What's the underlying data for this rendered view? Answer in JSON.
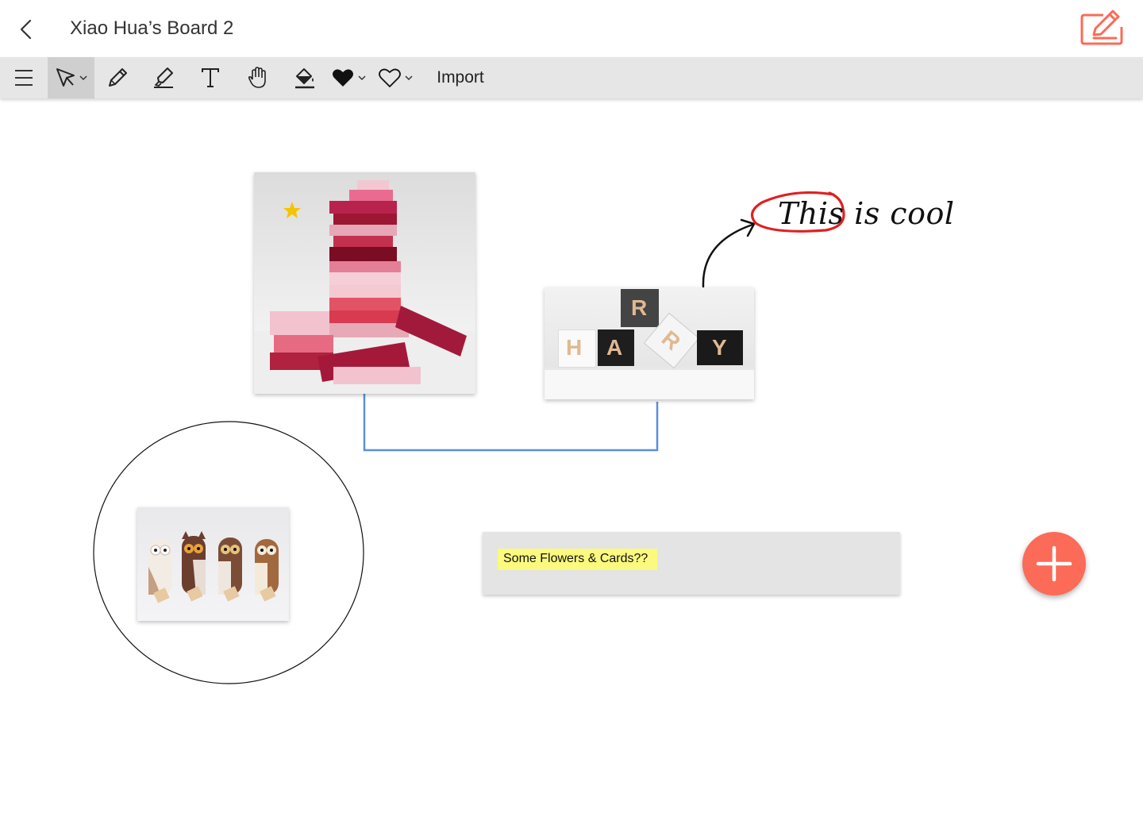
{
  "header": {
    "title": "Xiao Hua’s Board 2",
    "back_icon": "chevron-left-icon",
    "edit_icon": "edit-note-icon",
    "accent_color": "#fb6b57"
  },
  "toolbar": {
    "tools": [
      {
        "name": "menu",
        "icon": "hamburger-menu-icon"
      },
      {
        "name": "select",
        "icon": "cursor-arrow-icon",
        "active": true
      },
      {
        "name": "pencil",
        "icon": "pencil-icon"
      },
      {
        "name": "highlighter",
        "icon": "highlighter-icon"
      },
      {
        "name": "text",
        "icon": "text-icon"
      },
      {
        "name": "pan",
        "icon": "hand-icon"
      },
      {
        "name": "fill",
        "icon": "fill-bucket-icon"
      },
      {
        "name": "fill-shape",
        "icon": "heart-filled-icon"
      },
      {
        "name": "outline-shape",
        "icon": "heart-outline-icon"
      }
    ],
    "import_label": "Import"
  },
  "canvas": {
    "images": [
      {
        "name": "jenga-tower-image",
        "subject": "pink and red stacked block tower with cards",
        "starred": true
      },
      {
        "name": "harry-blocks-image",
        "subject": "letter blocks spelling HARRY",
        "letters": [
          "H",
          "A",
          "R",
          "R",
          "Y"
        ]
      },
      {
        "name": "owl-clips-image",
        "subject": "four wooden owl clips"
      }
    ],
    "annotation": {
      "text_circled": "This",
      "text_rest": "is cool",
      "circle_color": "#e02020"
    },
    "connector_color": "#5b8fdc",
    "sticky_note": {
      "text": "Some Flowers & Cards??",
      "highlight_color": "#fbf97e"
    }
  },
  "fab": {
    "icon": "plus-icon",
    "color": "#fb6b57"
  }
}
